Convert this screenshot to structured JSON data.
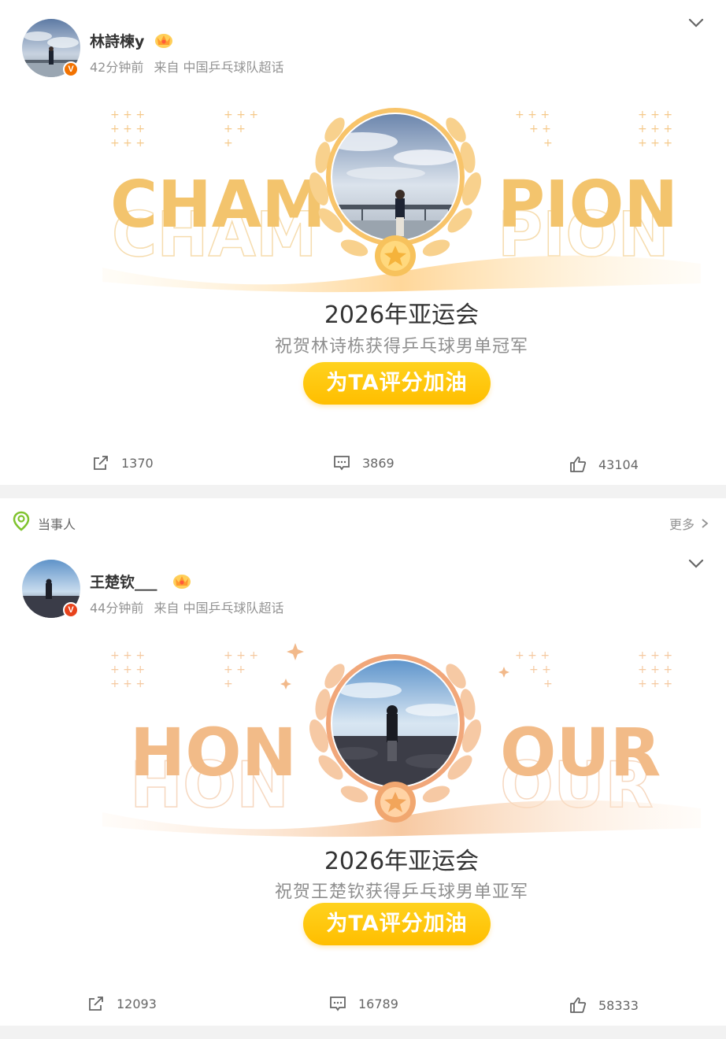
{
  "posts": [
    {
      "username": "林詩楝y",
      "time": "42分钟前",
      "source": "来自 中国乒乓球队超话",
      "banner": {
        "word_left": "CHAM",
        "word_right": "PION",
        "title": "2026年亚运会",
        "subtitle": "祝贺林诗栋获得乒乓球男单冠军",
        "cta": "为TA评分加油"
      },
      "actions": {
        "share": "1370",
        "comment": "3869",
        "like": "43104"
      }
    },
    {
      "username": "王楚钦___",
      "time": "44分钟前",
      "source": "来自 中国乒乓球队超话",
      "banner": {
        "word_left": "HON",
        "word_right": "OUR",
        "title": "2026年亚运会",
        "subtitle": "祝贺王楚钦获得乒乓球男单亚军",
        "cta": "为TA评分加油"
      },
      "actions": {
        "share": "12093",
        "comment": "16789",
        "like": "58333"
      }
    }
  ],
  "topic_bar": {
    "label": "当事人",
    "more": "更多"
  },
  "colors": {
    "champion_text": "#f3c46d",
    "honour_text": "#f2bb88",
    "cta": "#ffc107",
    "verified_orange": "#f27200"
  }
}
